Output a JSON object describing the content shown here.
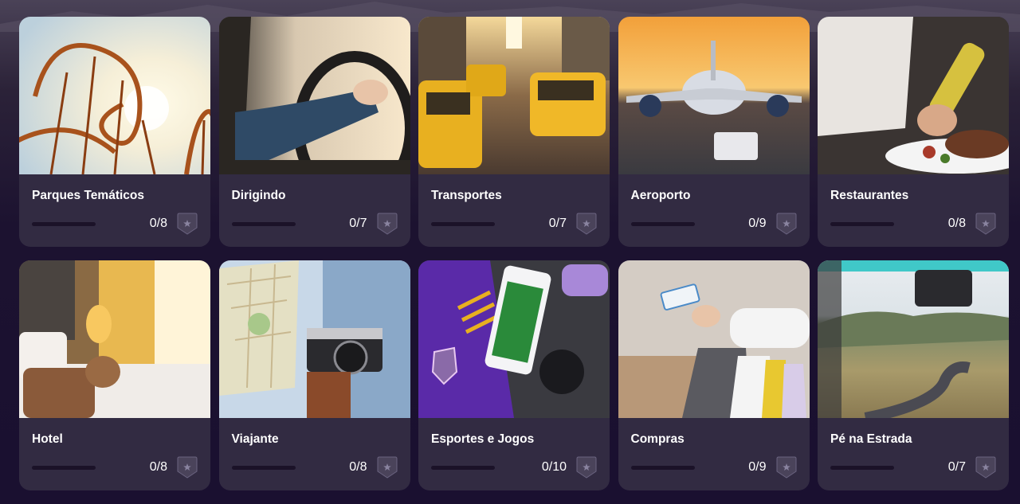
{
  "categories": [
    {
      "title": "Parques Temáticos",
      "completed": 0,
      "total": 8,
      "count_label": "0/8",
      "image": "roller-coaster",
      "badge_icon": "star-shield-icon"
    },
    {
      "title": "Dirigindo",
      "completed": 0,
      "total": 7,
      "count_label": "0/7",
      "image": "driving-steering-wheel",
      "badge_icon": "star-shield-icon"
    },
    {
      "title": "Transportes",
      "completed": 0,
      "total": 7,
      "count_label": "0/7",
      "image": "yellow-taxis",
      "badge_icon": "star-shield-icon"
    },
    {
      "title": "Aeroporto",
      "completed": 0,
      "total": 9,
      "count_label": "0/9",
      "image": "airplane-sunset",
      "badge_icon": "star-shield-icon"
    },
    {
      "title": "Restaurantes",
      "completed": 0,
      "total": 8,
      "count_label": "0/8",
      "image": "chef-plating",
      "badge_icon": "star-shield-icon"
    },
    {
      "title": "Hotel",
      "completed": 0,
      "total": 8,
      "count_label": "0/8",
      "image": "hotel-room",
      "badge_icon": "star-shield-icon"
    },
    {
      "title": "Viajante",
      "completed": 0,
      "total": 8,
      "count_label": "0/8",
      "image": "map-camera",
      "badge_icon": "star-shield-icon"
    },
    {
      "title": "Esportes e Jogos",
      "completed": 0,
      "total": 10,
      "count_label": "0/10",
      "image": "soccer-phone-jersey",
      "badge_icon": "star-shield-icon"
    },
    {
      "title": "Compras",
      "completed": 0,
      "total": 9,
      "count_label": "0/9",
      "image": "shopping-bags-card",
      "badge_icon": "star-shield-icon"
    },
    {
      "title": "Pé na Estrada",
      "completed": 0,
      "total": 7,
      "count_label": "0/7",
      "image": "road-trip",
      "badge_icon": "star-shield-icon"
    }
  ],
  "colors": {
    "card_bg": "#322b42",
    "page_bg": "#1c1230",
    "progress_track": "#1b1228",
    "progress_fill": "#8a6cff",
    "badge_bg": "#4a435a",
    "text": "#ffffff"
  }
}
